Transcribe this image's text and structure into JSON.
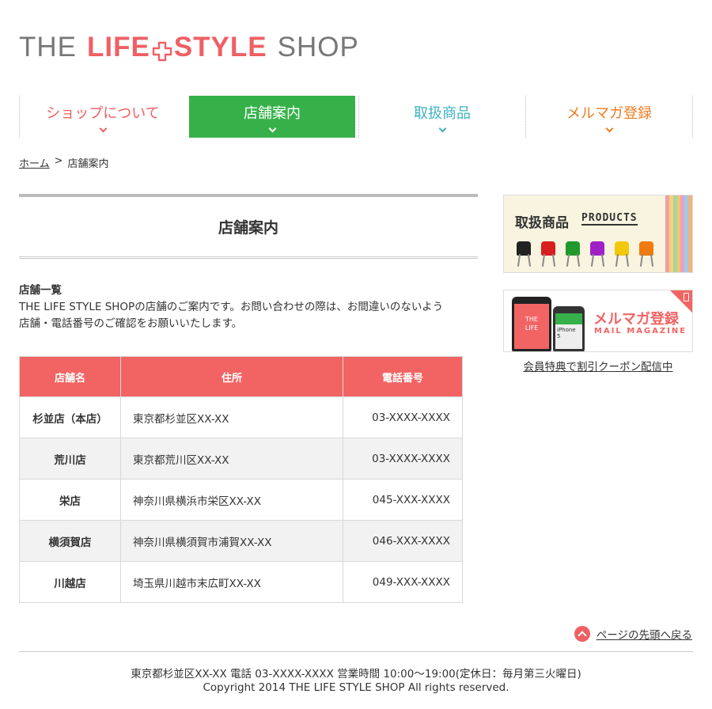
{
  "logo": {
    "part1": "THE",
    "part2": "LIFE",
    "part3": "STYLE",
    "part4": "SHOP"
  },
  "nav": [
    {
      "label": "ショップについて",
      "color": "#ee6063"
    },
    {
      "label": "店舗案内",
      "color": "#ffffff",
      "active": true
    },
    {
      "label": "取扱商品",
      "color": "#3eb2c2"
    },
    {
      "label": "メルマガ登録",
      "color": "#ef7d21"
    }
  ],
  "breadcrumb": {
    "home": "ホーム",
    "separator": ">",
    "current": "店舗案内"
  },
  "main": {
    "title": "店舗案内",
    "intro_title": "店舗一覧",
    "intro_line1": "THE LIFE STYLE SHOPの店舗のご案内です。お問い合わせの際は、お間違いのないよう",
    "intro_line2": "店舗・電話番号のご確認をお願いいたします。"
  },
  "table": {
    "headers": [
      "店舗名",
      "住所",
      "電話番号"
    ],
    "rows": [
      [
        "杉並店（本店）",
        "東京都杉並区XX-XX",
        "03-XXXX-XXXX"
      ],
      [
        "荒川店",
        "東京都荒川区XX-XX",
        "03-XXXX-XXXX"
      ],
      [
        "栄店",
        "神奈川県横浜市栄区XX-XX",
        "045-XXX-XXXX"
      ],
      [
        "横須賀店",
        "神奈川県横須賀市浦賀XX-XX",
        "046-XXX-XXXX"
      ],
      [
        "川越店",
        "埼玉県川越市末広町XX-XX",
        "049-XXX-XXXX"
      ]
    ]
  },
  "sidebar": {
    "products_title": "取扱商品",
    "products_sub": "PRODUCTS",
    "mail_title": "メルマガ登録",
    "mail_sub": "MAIL MAGAZINE",
    "phone_text1": "THE",
    "phone_text2": "LIFE",
    "phone_text3": "iPhone 5",
    "mail_link": "会員特典で割引クーポン配信中"
  },
  "pagetop": "ページの先頭へ戻る",
  "footer": {
    "line1": "東京都杉並区XX-XX 電話 03-XXXX-XXXX 営業時間 10:00～19:00(定休日：毎月第三火曜日)",
    "line2": "Copyright 2014 THE LIFE STYLE SHOP All rights reserved."
  },
  "colors": {
    "accent_red": "#f26464",
    "nav_active": "#36b14a"
  }
}
